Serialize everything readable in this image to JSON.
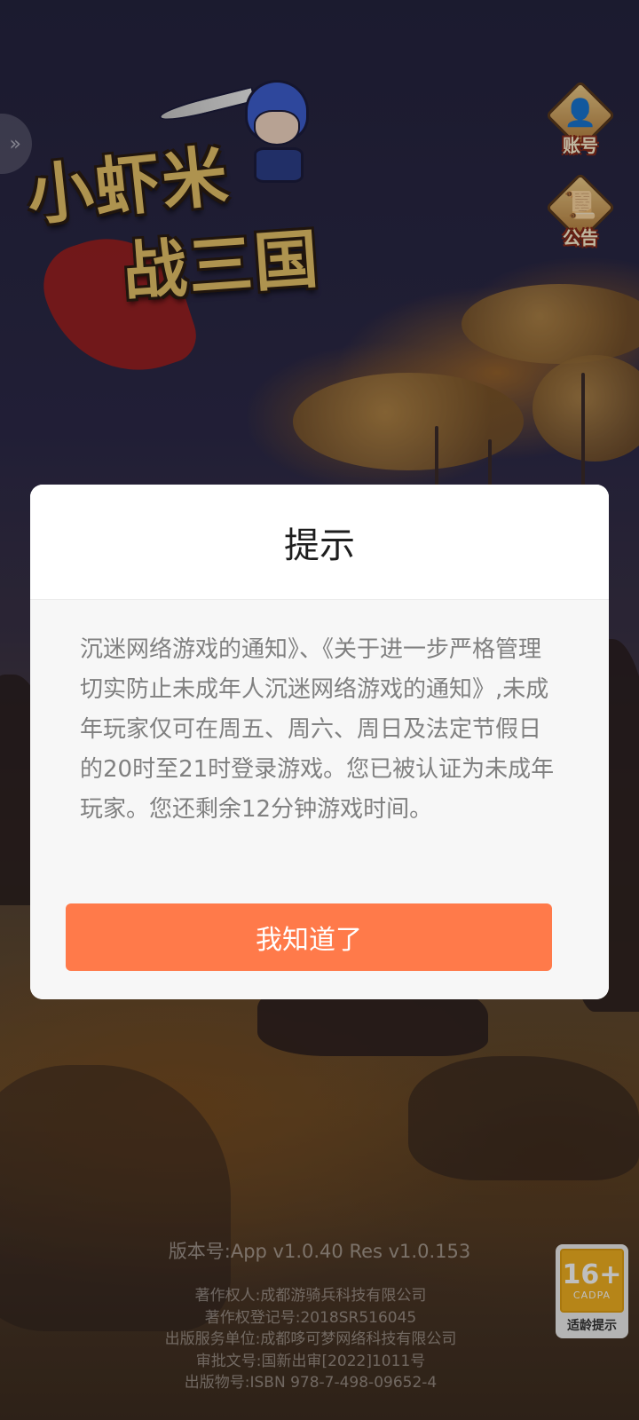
{
  "logo": {
    "line1": "小虾米",
    "line2": "战三国"
  },
  "left_tab": {
    "icon": "chevron-right-double-icon",
    "glyph": "»"
  },
  "side_buttons": {
    "account": {
      "label": "账号",
      "icon": "avatar-icon",
      "glyph": "👤"
    },
    "notice": {
      "label": "公告",
      "icon": "notice-board-icon",
      "glyph": "📜"
    }
  },
  "dialog": {
    "title": "提示",
    "message": "沉迷网络游戏的通知》、《关于进一步严格管理切实防止未成年人沉迷网络游戏的通知》,未成年玩家仅可在周五、周六、周日及法定节假日的20时至21时登录游戏。您已被认证为未成年玩家。您还剩余12分钟游戏时间。",
    "confirm_label": "我知道了",
    "accent_color": "#ff7a4a"
  },
  "footer": {
    "version": "版本号:App v1.0.40 Res v1.0.153",
    "credits": [
      "著作权人:成都游骑兵科技有限公司",
      "著作权登记号:2018SR516045",
      "出版服务单位:成都哆可梦网络科技有限公司",
      "审批文号:国新出审[2022]1011号",
      "出版物号:ISBN 978-7-498-09652-4"
    ]
  },
  "age_rating": {
    "number": "16+",
    "org": "CADPA",
    "label": "适龄提示",
    "color": "#f3b221"
  }
}
